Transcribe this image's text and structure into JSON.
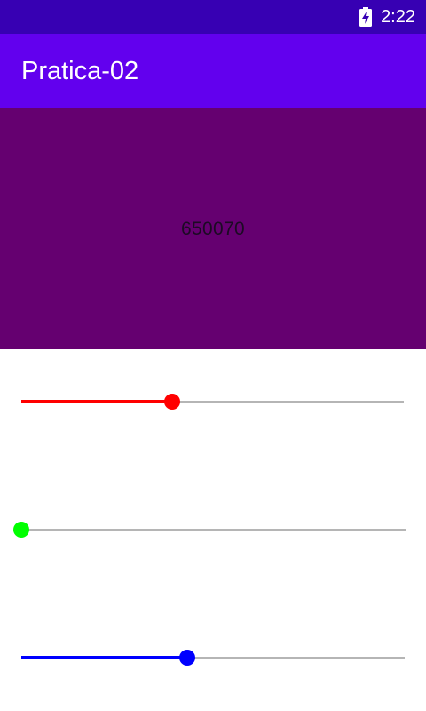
{
  "status_bar": {
    "time": "2:22",
    "battery_icon": "battery-charging-icon",
    "background": "#3700b3"
  },
  "app_bar": {
    "title": "Pratica-02",
    "background": "#6200ee"
  },
  "preview": {
    "text": "650070",
    "background": "#650070"
  },
  "sliders": [
    {
      "name": "red",
      "color": "#ff0000",
      "value_fraction": 0.4
    },
    {
      "name": "green",
      "color": "#00ff00",
      "value_fraction": 0.0
    },
    {
      "name": "blue",
      "color": "#0000ff",
      "value_fraction": 0.44
    }
  ]
}
